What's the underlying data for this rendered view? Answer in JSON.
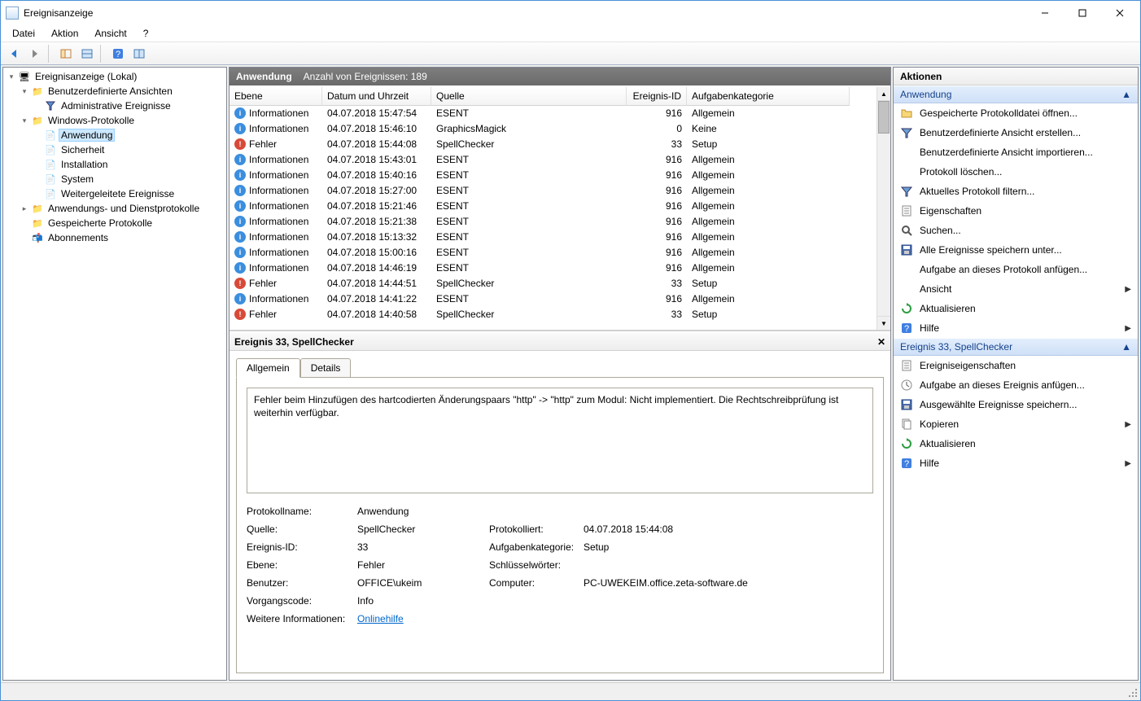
{
  "title": "Ereignisanzeige",
  "menu": {
    "file": "Datei",
    "action": "Aktion",
    "view": "Ansicht",
    "help": "?"
  },
  "tree": {
    "root": "Ereignisanzeige (Lokal)",
    "customViews": "Benutzerdefinierte Ansichten",
    "adminEvents": "Administrative Ereignisse",
    "winLogs": "Windows-Protokolle",
    "application": "Anwendung",
    "security": "Sicherheit",
    "installation": "Installation",
    "system": "System",
    "forwarded": "Weitergeleitete Ereignisse",
    "appServices": "Anwendungs- und Dienstprotokolle",
    "savedLogs": "Gespeicherte Protokolle",
    "subscriptions": "Abonnements"
  },
  "centerHeader": {
    "title": "Anwendung",
    "count": "Anzahl von Ereignissen: 189"
  },
  "columns": {
    "level": "Ebene",
    "datetime": "Datum und Uhrzeit",
    "source": "Quelle",
    "eventId": "Ereignis-ID",
    "taskCat": "Aufgabenkategorie"
  },
  "levels": {
    "info": "Informationen",
    "error": "Fehler"
  },
  "categories": {
    "general": "Allgemein",
    "none": "Keine",
    "setup": "Setup"
  },
  "events": [
    {
      "lvl": "info",
      "dt": "04.07.2018 15:47:54",
      "src": "ESENT",
      "id": 916,
      "cat": "general"
    },
    {
      "lvl": "info",
      "dt": "04.07.2018 15:46:10",
      "src": "GraphicsMagick",
      "id": 0,
      "cat": "none"
    },
    {
      "lvl": "error",
      "dt": "04.07.2018 15:44:08",
      "src": "SpellChecker",
      "id": 33,
      "cat": "setup",
      "selected": true
    },
    {
      "lvl": "info",
      "dt": "04.07.2018 15:43:01",
      "src": "ESENT",
      "id": 916,
      "cat": "general"
    },
    {
      "lvl": "info",
      "dt": "04.07.2018 15:40:16",
      "src": "ESENT",
      "id": 916,
      "cat": "general"
    },
    {
      "lvl": "info",
      "dt": "04.07.2018 15:27:00",
      "src": "ESENT",
      "id": 916,
      "cat": "general"
    },
    {
      "lvl": "info",
      "dt": "04.07.2018 15:21:46",
      "src": "ESENT",
      "id": 916,
      "cat": "general"
    },
    {
      "lvl": "info",
      "dt": "04.07.2018 15:21:38",
      "src": "ESENT",
      "id": 916,
      "cat": "general"
    },
    {
      "lvl": "info",
      "dt": "04.07.2018 15:13:32",
      "src": "ESENT",
      "id": 916,
      "cat": "general"
    },
    {
      "lvl": "info",
      "dt": "04.07.2018 15:00:16",
      "src": "ESENT",
      "id": 916,
      "cat": "general"
    },
    {
      "lvl": "info",
      "dt": "04.07.2018 14:46:19",
      "src": "ESENT",
      "id": 916,
      "cat": "general"
    },
    {
      "lvl": "error",
      "dt": "04.07.2018 14:44:51",
      "src": "SpellChecker",
      "id": 33,
      "cat": "setup"
    },
    {
      "lvl": "info",
      "dt": "04.07.2018 14:41:22",
      "src": "ESENT",
      "id": 916,
      "cat": "general"
    },
    {
      "lvl": "error",
      "dt": "04.07.2018 14:40:58",
      "src": "SpellChecker",
      "id": 33,
      "cat": "setup"
    }
  ],
  "detailTitle": "Ereignis 33, SpellChecker",
  "tabGeneral": "Allgemein",
  "tabDetails": "Details",
  "description": "Fehler beim Hinzufügen des hartcodierten Änderungspaars \"http\" -> \"http\" zum Modul: Nicht implementiert. Die Rechtschreibprüfung ist weiterhin verfügbar.",
  "props": {
    "logNameL": "Protokollname:",
    "logNameV": "Anwendung",
    "sourceL": "Quelle:",
    "sourceV": "SpellChecker",
    "loggedL": "Protokolliert:",
    "loggedV": "04.07.2018 15:44:08",
    "eventIdL": "Ereignis-ID:",
    "eventIdV": "33",
    "taskCatL": "Aufgabenkategorie:",
    "taskCatV": "Setup",
    "levelL": "Ebene:",
    "levelV": "Fehler",
    "keywordsL": "Schlüsselwörter:",
    "keywordsV": "",
    "userL": "Benutzer:",
    "userV": "OFFICE\\ukeim",
    "computerL": "Computer:",
    "computerV": "PC-UWEKEIM.office.zeta-software.de",
    "opcodeL": "Vorgangscode:",
    "opcodeV": "Info",
    "moreInfoL": "Weitere Informationen:",
    "moreInfoV": "Onlinehilfe"
  },
  "actionsTitle": "Aktionen",
  "actionsGroup1": "Anwendung",
  "actions1": [
    {
      "icon": "folder",
      "label": "Gespeicherte Protokolldatei öffnen..."
    },
    {
      "icon": "filter",
      "label": "Benutzerdefinierte Ansicht erstellen..."
    },
    {
      "icon": "",
      "label": "Benutzerdefinierte Ansicht importieren..."
    },
    {
      "icon": "",
      "label": "Protokoll löschen..."
    },
    {
      "icon": "filter",
      "label": "Aktuelles Protokoll filtern..."
    },
    {
      "icon": "props",
      "label": "Eigenschaften"
    },
    {
      "icon": "search",
      "label": "Suchen..."
    },
    {
      "icon": "save",
      "label": "Alle Ereignisse speichern unter..."
    },
    {
      "icon": "",
      "label": "Aufgabe an dieses Protokoll anfügen..."
    },
    {
      "icon": "",
      "label": "Ansicht",
      "sub": true
    },
    {
      "icon": "refresh",
      "label": "Aktualisieren"
    },
    {
      "icon": "help",
      "label": "Hilfe",
      "sub": true
    }
  ],
  "actionsGroup2": "Ereignis 33, SpellChecker",
  "actions2": [
    {
      "icon": "props",
      "label": "Ereigniseigenschaften"
    },
    {
      "icon": "task",
      "label": "Aufgabe an dieses Ereignis anfügen..."
    },
    {
      "icon": "save",
      "label": "Ausgewählte Ereignisse speichern..."
    },
    {
      "icon": "copy",
      "label": "Kopieren",
      "sub": true
    },
    {
      "icon": "refresh",
      "label": "Aktualisieren"
    },
    {
      "icon": "help",
      "label": "Hilfe",
      "sub": true
    }
  ]
}
